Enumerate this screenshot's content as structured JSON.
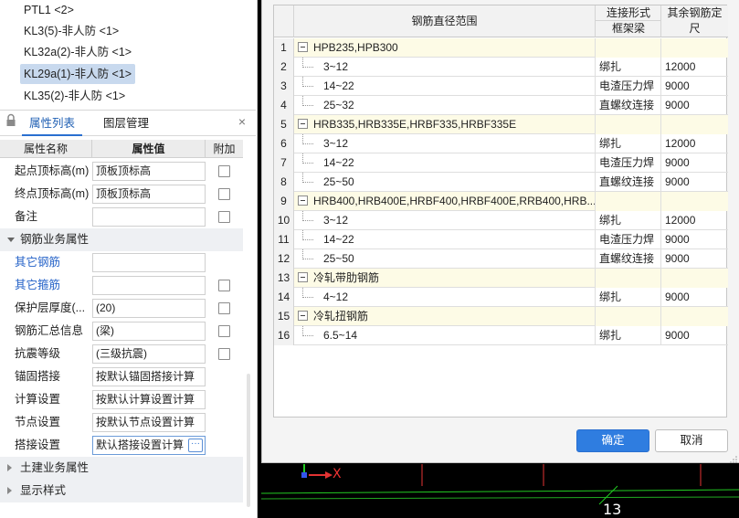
{
  "tree": {
    "items": [
      {
        "label": "PTL1 <2>",
        "selected": false
      },
      {
        "label": "KL3(5)-非人防 <1>",
        "selected": false
      },
      {
        "label": "KL32a(2)-非人防 <1>",
        "selected": false
      },
      {
        "label": "KL29a(1)-非人防 <1>",
        "selected": true
      },
      {
        "label": "KL35(2)-非人防 <1>",
        "selected": false
      }
    ]
  },
  "panel": {
    "tabs": [
      "属性列表",
      "图层管理"
    ],
    "close_label": "×",
    "columns": {
      "name": "属性名称",
      "value": "属性值",
      "add": "附加"
    },
    "rows_top": [
      {
        "name": "起点顶标高(m)",
        "value": "顶板顶标高",
        "check": true
      },
      {
        "name": "终点顶标高(m)",
        "value": "顶板顶标高",
        "check": true
      },
      {
        "name": "备注",
        "value": "",
        "check": true
      }
    ],
    "group_steel": "钢筋业务属性",
    "rows_steel": [
      {
        "name": "其它钢筋",
        "value": "",
        "check": false,
        "blue": true
      },
      {
        "name": "其它箍筋",
        "value": "",
        "check": true,
        "blue": true
      },
      {
        "name": "保护层厚度(...",
        "value": "(20)",
        "check": true
      },
      {
        "name": "钢筋汇总信息",
        "value": "(梁)",
        "check": true
      },
      {
        "name": "抗震等级",
        "value": "(三级抗震)",
        "check": true
      },
      {
        "name": "锚固搭接",
        "value": "按默认锚固搭接计算",
        "check": false
      },
      {
        "name": "计算设置",
        "value": "按默认计算设置计算",
        "check": false
      },
      {
        "name": "节点设置",
        "value": "按默认节点设置计算",
        "check": false
      },
      {
        "name": "搭接设置",
        "value": "默认搭接设置计算",
        "check": false,
        "active": true
      }
    ],
    "dots_label": "···",
    "group_civil": "土建业务属性",
    "group_display": "显示样式"
  },
  "dialog": {
    "header": {
      "range": "钢筋直径范围",
      "conn_top": "连接形式",
      "conn_sub": "框架梁",
      "rest_top": "其余钢筋定",
      "rest_bottom": "尺"
    },
    "rows": [
      {
        "num": "1",
        "range": "HPB235,HPB300",
        "conn": "",
        "len": "",
        "group": true
      },
      {
        "num": "2",
        "range": "3~12",
        "conn": "绑扎",
        "len": "12000",
        "group": false
      },
      {
        "num": "3",
        "range": "14~22",
        "conn": "电渣压力焊",
        "len": "9000",
        "group": false
      },
      {
        "num": "4",
        "range": "25~32",
        "conn": "直螺纹连接",
        "len": "9000",
        "group": false
      },
      {
        "num": "5",
        "range": "HRB335,HRB335E,HRBF335,HRBF335E",
        "conn": "",
        "len": "",
        "group": true
      },
      {
        "num": "6",
        "range": "3~12",
        "conn": "绑扎",
        "len": "12000",
        "group": false
      },
      {
        "num": "7",
        "range": "14~22",
        "conn": "电渣压力焊",
        "len": "9000",
        "group": false
      },
      {
        "num": "8",
        "range": "25~50",
        "conn": "直螺纹连接",
        "len": "9000",
        "group": false
      },
      {
        "num": "9",
        "range": "HRB400,HRB400E,HRBF400,HRBF400E,RRB400,HRB...",
        "conn": "",
        "len": "",
        "group": true
      },
      {
        "num": "10",
        "range": "3~12",
        "conn": "绑扎",
        "len": "12000",
        "group": false
      },
      {
        "num": "11",
        "range": "14~22",
        "conn": "电渣压力焊",
        "len": "9000",
        "group": false
      },
      {
        "num": "12",
        "range": "25~50",
        "conn": "直螺纹连接",
        "len": "9000",
        "group": false
      },
      {
        "num": "13",
        "range": "冷轧带肋钢筋",
        "conn": "",
        "len": "",
        "group": true
      },
      {
        "num": "14",
        "range": "4~12",
        "conn": "绑扎",
        "len": "9000",
        "group": false
      },
      {
        "num": "15",
        "range": "冷轧扭钢筋",
        "conn": "",
        "len": "",
        "group": true
      },
      {
        "num": "16",
        "range": "6.5~14",
        "conn": "绑扎",
        "len": "9000",
        "group": false
      }
    ],
    "ok_label": "确定",
    "cancel_label": "取消"
  },
  "canvas": {
    "axis_label": "X",
    "number_label": "13"
  },
  "colors": {
    "accent": "#2f7de0",
    "group_row": "#fdfbe6",
    "axis_red": "#e33333",
    "axis_green": "#22cc22"
  }
}
